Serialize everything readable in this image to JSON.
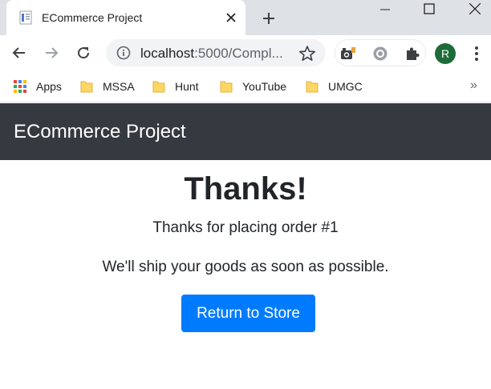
{
  "browser": {
    "tab": {
      "title": "ECommerce Project"
    },
    "address": {
      "host": "localhost",
      "rest": ":5000/Compl..."
    },
    "profile_initial": "R",
    "bookmarks": [
      {
        "label": "Apps",
        "icon": "apps-grid-icon"
      },
      {
        "label": "MSSA",
        "icon": "folder-icon"
      },
      {
        "label": "Hunt",
        "icon": "folder-icon"
      },
      {
        "label": "YouTube",
        "icon": "folder-icon"
      },
      {
        "label": "UMGC",
        "icon": "folder-icon"
      }
    ],
    "bookmarks_more": "»"
  },
  "page": {
    "brand": "ECommerce Project",
    "heading": "Thanks!",
    "order_message": "Thanks for placing order #1",
    "ship_message": "We'll ship your goods as soon as possible.",
    "return_button": "Return to Store"
  },
  "colors": {
    "navbar": "#343a40",
    "primary": "#007bff",
    "tabstrip": "#dee1e6",
    "avatar": "#1e6b3a"
  }
}
